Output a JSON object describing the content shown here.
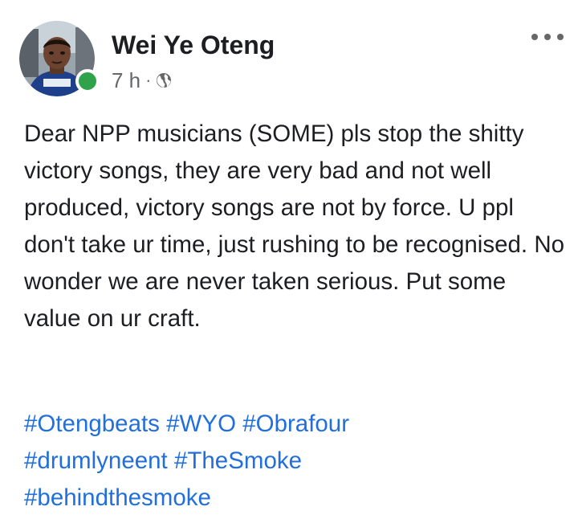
{
  "post": {
    "author_name": "Wei Ye Oteng",
    "timestamp": "7 h",
    "separator": "·",
    "privacy_icon": "globe-icon",
    "more_icon": "ellipsis-horizontal-icon",
    "online_status_color": "#31a24c",
    "text": "Dear NPP musicians (SOME) pls stop the shitty victory songs, they are very bad and not well produced,  victory songs are not by force. U ppl don't take ur time, just rushing to be recognised. No wonder we are never taken serious. Put some value on ur craft.",
    "hashtags": [
      "#Otengbeats",
      "#WYO",
      "#Obrafour",
      "#drumlyneent",
      "#TheSmoke",
      "#behindthesmoke"
    ],
    "hashtag_color": "#216fdb"
  }
}
